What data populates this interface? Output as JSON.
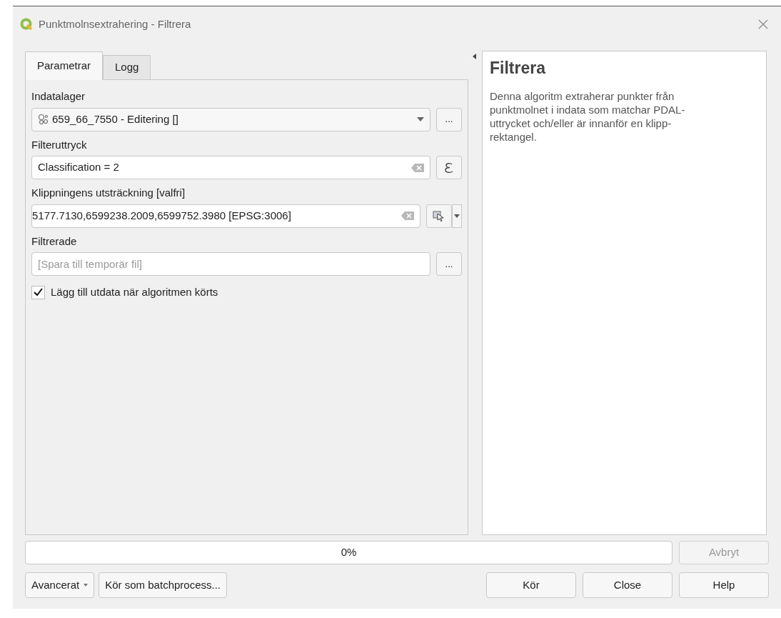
{
  "window": {
    "title": "Punktmolnsextrahering - Filtrera"
  },
  "tabs": [
    {
      "label": "Parametrar",
      "selected": true
    },
    {
      "label": "Logg",
      "selected": false
    }
  ],
  "parameters": [
    {
      "kind": "layer",
      "label": "Indatalager",
      "value": "659_66_7550 - Editering []",
      "button": "..."
    },
    {
      "kind": "expression",
      "label": "Filteruttryck",
      "value": "Classification = 2"
    },
    {
      "kind": "extent",
      "label": "Klippningens utsträckning [valfri]",
      "value": "5177.7130,6599238.2009,6599752.3980 [EPSG:3006]"
    },
    {
      "kind": "output",
      "label": "Filtrerade",
      "placeholder": "[Spara till temporär fil]",
      "button": "..."
    },
    {
      "kind": "checkbox",
      "label": "Lägg till utdata när algoritmen körts",
      "checked": true
    }
  ],
  "help": {
    "title": "Filtrera",
    "text": "Denna algoritm extraherar punkter från punktmolnet i indata som matchar PDAL-uttrycket och/eller är innanför en klipp-rektangel."
  },
  "progress": {
    "level": 0,
    "reading": "0%"
  },
  "cancel_button": {
    "label": "Avbryt",
    "disabled": true
  },
  "buttons_left": [
    {
      "label": "Avancerat",
      "dropdown": true
    },
    {
      "label": "Kör som batchprocess...",
      "dropdown": false
    }
  ],
  "buttons_right": [
    "Kör",
    "Close",
    "Help"
  ]
}
